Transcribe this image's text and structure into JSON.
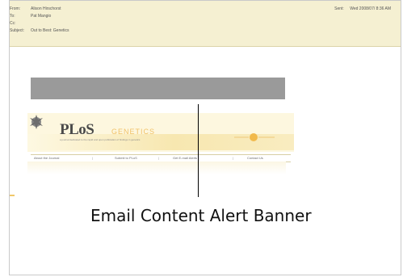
{
  "email_header": {
    "from_label": "From:",
    "from_value": "Alison Hirschorst",
    "to_label": "To:",
    "to_value": "Pat Mangio",
    "cc_label": "Cc:",
    "cc_value": "",
    "subject_label": "Subject:",
    "subject_value": "Out to Best: Genetics",
    "sent_label": "Sent:",
    "sent_value": "Wed 2008/07/ 8:36 AM"
  },
  "banner": {
    "plos": "PLoS",
    "journal": "GENETICS",
    "tagline": "a journal dedicated to the rapid and open publication of findings in genetics"
  },
  "nav": {
    "items": [
      "About the Journal",
      "Submit to PLoS",
      "Get E-mail Alerts",
      "Contact Us"
    ]
  },
  "annotation": {
    "caption": "Email Content Alert Banner"
  },
  "colors": {
    "header_bg": "#f5f0d2",
    "alert_bar": "#9a9a9a",
    "genetics_orange": "#f1c267"
  }
}
